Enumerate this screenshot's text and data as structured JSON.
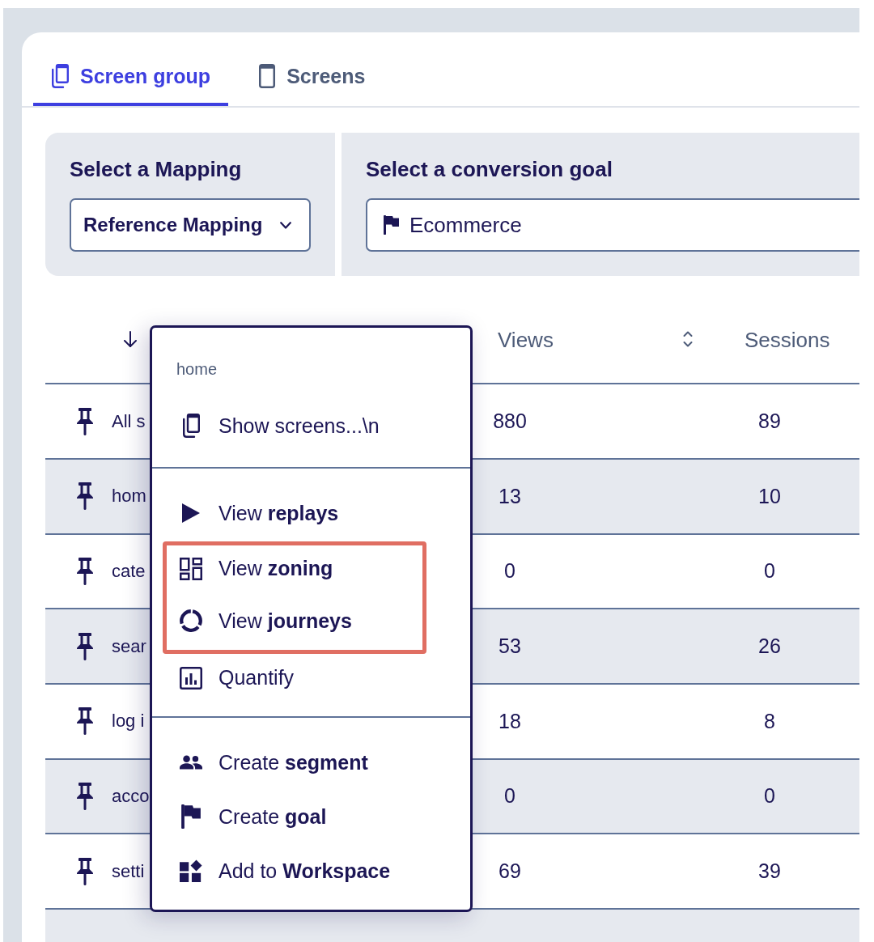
{
  "tabs": [
    {
      "label": "Screen group",
      "selected": true
    },
    {
      "label": "Screens",
      "selected": false
    }
  ],
  "filters": [
    {
      "kind": "dropdown",
      "label": "Select a Mapping",
      "value": "Reference Mapping"
    },
    {
      "kind": "goal",
      "label": "Select a conversion goal",
      "value": "Ecommerce"
    }
  ],
  "table": {
    "columns": [
      "Views",
      "Sessions"
    ],
    "rows": [
      {
        "name": "All s",
        "views": "880",
        "sessions": "89"
      },
      {
        "name": "hom",
        "views": "13",
        "sessions": "10"
      },
      {
        "name": "cate",
        "views": "0",
        "sessions": "0"
      },
      {
        "name": "sear",
        "views": "53",
        "sessions": "26"
      },
      {
        "name": "log i",
        "views": "18",
        "sessions": "8"
      },
      {
        "name": "acco",
        "views": "0",
        "sessions": "0"
      },
      {
        "name": "setti",
        "views": "69",
        "sessions": "39"
      }
    ]
  },
  "context_menu": {
    "title": "home",
    "sections": [
      {
        "items": [
          {
            "label": "Show screens...\\n",
            "highlighted": false
          }
        ]
      },
      {
        "items": [
          {
            "label": "View **replays**",
            "highlighted": false
          },
          {
            "label": "View **zoning**",
            "highlighted": true
          },
          {
            "label": "View **journeys**",
            "highlighted": true
          },
          {
            "label": "Quantify",
            "highlighted": false
          }
        ]
      },
      {
        "items": [
          {
            "label": "Create **segment**",
            "highlighted": false
          },
          {
            "label": "Create **goal**",
            "highlighted": false
          },
          {
            "label": "Add to **Workspace**",
            "highlighted": false
          }
        ]
      }
    ]
  }
}
